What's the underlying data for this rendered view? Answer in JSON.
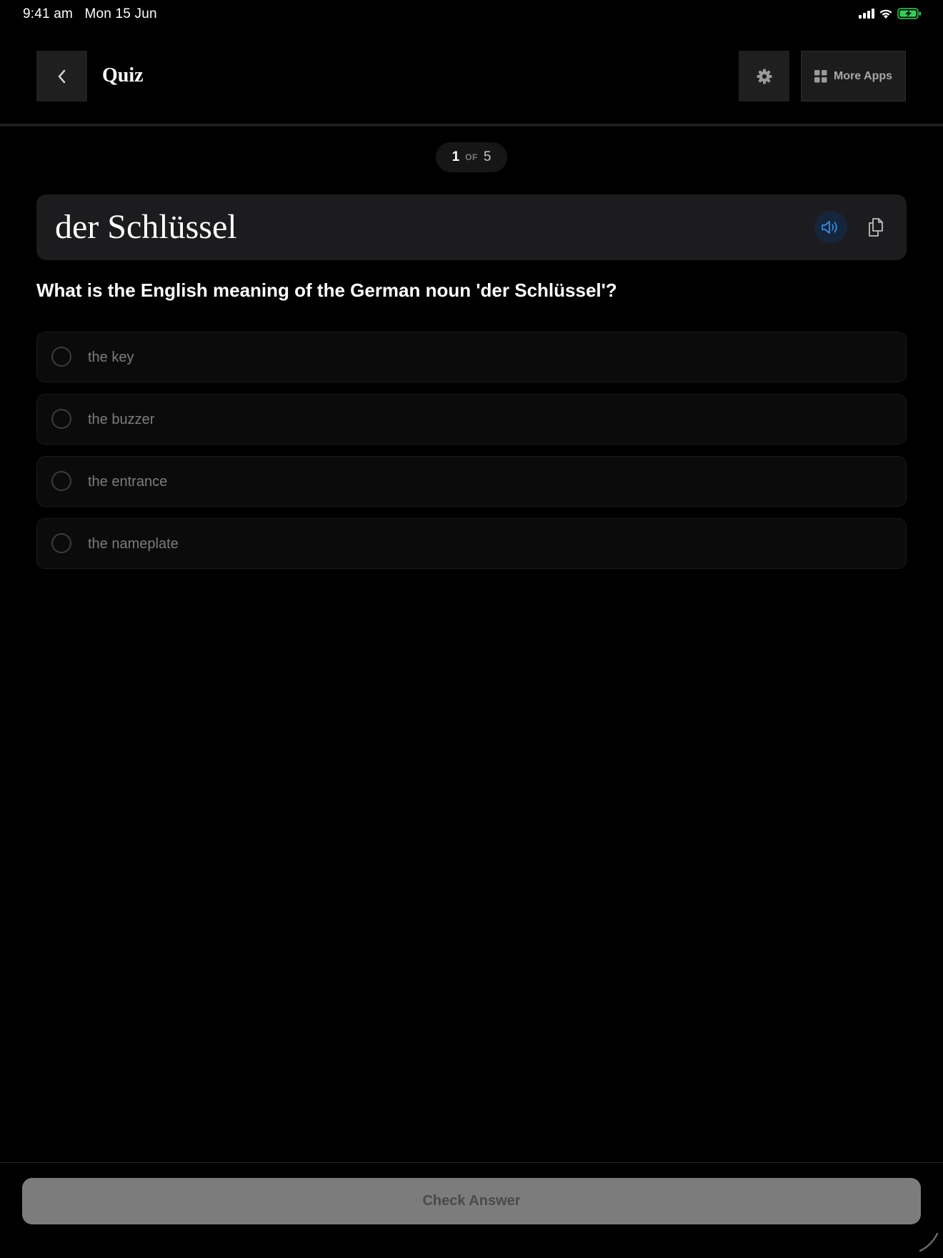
{
  "status_bar": {
    "time": "9:41 am",
    "date": "Mon 15 Jun",
    "signal_icon": "cellular-signal-icon",
    "wifi_icon": "wifi-icon",
    "battery_icon": "battery-charging-icon",
    "battery_color": "#30d158"
  },
  "header": {
    "back_icon": "chevron-left-icon",
    "title": "Quiz",
    "settings_icon": "gear-icon",
    "more_apps_icon": "grid-icon",
    "more_apps_label": "More Apps"
  },
  "progress": {
    "current": "1",
    "of_label": "OF",
    "total": "5"
  },
  "word_card": {
    "word": "der Schlüssel",
    "audio_icon": "speaker-icon",
    "copy_icon": "copy-icon",
    "accent_color": "#2f8ff0"
  },
  "question": "What is the English meaning of the German noun 'der Schlüssel'?",
  "options": [
    {
      "label": "the key"
    },
    {
      "label": "the buzzer"
    },
    {
      "label": "the entrance"
    },
    {
      "label": "the nameplate"
    }
  ],
  "check_button": {
    "label": "Check Answer"
  }
}
